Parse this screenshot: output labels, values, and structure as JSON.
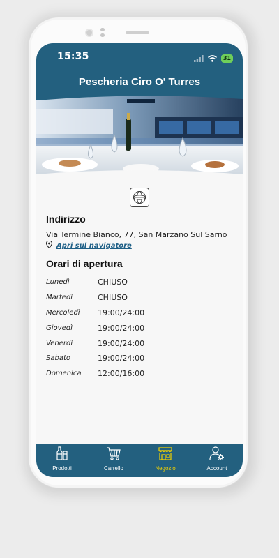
{
  "status_bar": {
    "time": "15:35",
    "battery": "31"
  },
  "header": {
    "title": "Pescheria Ciro O' Turres"
  },
  "store": {
    "address_title": "Indirizzo",
    "address": "Via Termine Bianco, 77, San Marzano Sul Sarno",
    "navigator_link": "Apri sul navigatore",
    "hours_title": "Orari di apertura",
    "hours": [
      {
        "day": "Lunedì",
        "time": "CHIUSO"
      },
      {
        "day": "Martedì",
        "time": "CHIUSO"
      },
      {
        "day": "Mercoledì",
        "time": "19:00/24:00"
      },
      {
        "day": "Giovedì",
        "time": "19:00/24:00"
      },
      {
        "day": "Venerdì",
        "time": "19:00/24:00"
      },
      {
        "day": "Sabato",
        "time": "19:00/24:00"
      },
      {
        "day": "Domenica",
        "time": "12:00/16:00"
      }
    ]
  },
  "tabbar": {
    "items": [
      {
        "label": "Prodotti",
        "icon": "bottles-icon",
        "active": false
      },
      {
        "label": "Carrello",
        "icon": "cart-icon",
        "active": false
      },
      {
        "label": "Negozio",
        "icon": "store-icon",
        "active": true
      },
      {
        "label": "Account",
        "icon": "user-settings-icon",
        "active": false
      }
    ]
  },
  "colors": {
    "primary": "#23607f",
    "active_tab": "#f0d000",
    "link": "#1e5f86"
  }
}
